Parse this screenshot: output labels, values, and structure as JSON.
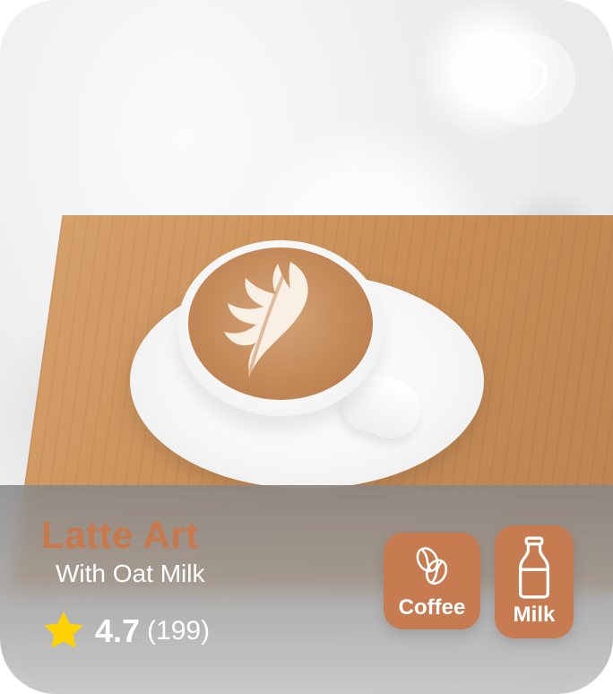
{
  "product": {
    "title": "Latte Art",
    "subtitle": "With Oat Milk",
    "rating": "4.7",
    "rating_count": "(199)"
  },
  "actions": {
    "favorite_icon": "heart-outline-icon"
  },
  "tags": [
    {
      "label": "Coffee",
      "icon": "coffee-beans-icon"
    },
    {
      "label": "Milk",
      "icon": "milk-bottle-icon"
    }
  ],
  "colors": {
    "accent": "#c9784b",
    "tag_background": "#c67b50",
    "star": "#ffd200",
    "overlay": "#8c8c8c"
  }
}
